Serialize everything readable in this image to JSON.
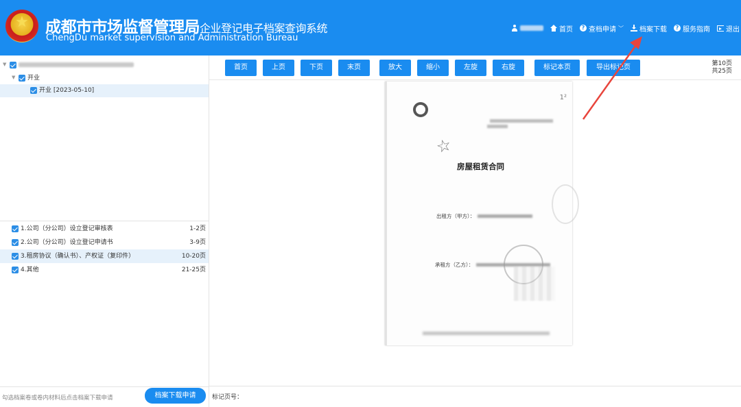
{
  "header": {
    "title_main": "成都市市场监督管理局",
    "title_sub": "企业登记电子档案查询系统",
    "title_en": "ChengDu market supervision and Administration Bureau",
    "nav": {
      "home": "首页",
      "apply": "查档申请",
      "download": "档案下载",
      "guide": "服务指南",
      "logout": "退出"
    },
    "brand_color": "#1a8cf0"
  },
  "tree": {
    "group_label": "开业",
    "record_label": "开业 [2023-05-10]"
  },
  "files": [
    {
      "label": "1.公司（分公司）设立登记审核表",
      "pages": "1-2页"
    },
    {
      "label": "2.公司（分公司）设立登记申请书",
      "pages": "3-9页"
    },
    {
      "label": "3.租房协议（确认书）、产权证（复印件）",
      "pages": "10-20页"
    },
    {
      "label": "4.其他",
      "pages": "21-25页"
    }
  ],
  "toolbar": {
    "first": "首页",
    "prev": "上页",
    "next": "下页",
    "last": "末页",
    "zoom_in": "放大",
    "zoom_out": "缩小",
    "rotate_left": "左旋",
    "rotate_right": "右旋",
    "mark_page": "标记本页",
    "export_marked": "导出标记页",
    "current_page": "第10页",
    "total_pages": "共25页"
  },
  "document": {
    "contract_no_label": "合同编号：",
    "title": "房屋租赁合同",
    "lessor_label": "出租方（甲方）：",
    "lessee_label": "承租方（乙方）：",
    "page_mark": "1²"
  },
  "footer": {
    "hint": "勾选档案卷或卷内材料后点击档案下载申请",
    "download_apply": "档案下载申请",
    "mark_label": "标记页号："
  }
}
